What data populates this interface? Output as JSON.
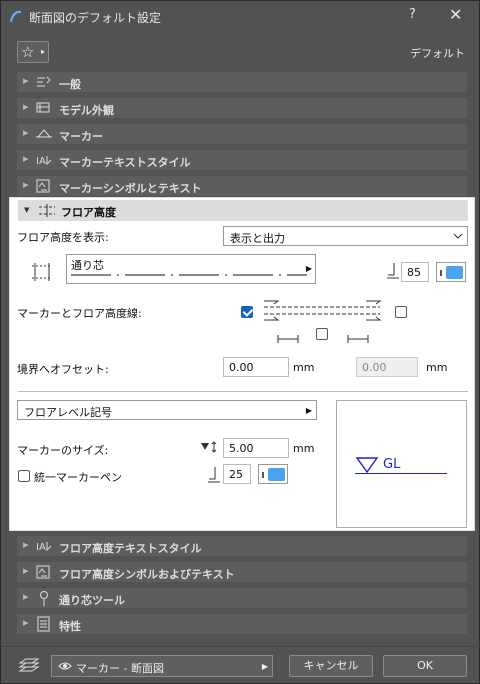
{
  "window": {
    "title": "断面図のデフォルト設定",
    "help": "?",
    "close": "✕"
  },
  "favorites": {
    "star": "☆",
    "arrow": "▸"
  },
  "default_label": "デフォルト",
  "sections": [
    {
      "label": "一般"
    },
    {
      "label": "モデル外観"
    },
    {
      "label": "マーカー"
    },
    {
      "label": "マーカーテキストスタイル"
    },
    {
      "label": "マーカーシンボルとテキスト"
    }
  ],
  "floor_panel": {
    "header": "フロア高度",
    "show_label": "フロア高度を表示:",
    "show_value": "表示と出力",
    "line_name": "通り芯",
    "pen_number": "85",
    "marker_line_label": "マーカーとフロア高度線:",
    "offset_label": "境界へオフセット:",
    "offset_value": "0.00",
    "offset_unit": "mm",
    "offset2_value": "0.00",
    "offset2_unit": "mm",
    "symbol_value": "フロアレベル記号",
    "marker_size_label": "マーカーのサイズ:",
    "marker_size_value": "5.00",
    "marker_size_unit": "mm",
    "uniform_pen_label": "統一マーカーペン",
    "marker_pen_number": "25",
    "preview_text": "GL"
  },
  "sections_after": [
    {
      "label": "フロア高度テキストスタイル"
    },
    {
      "label": "フロア高度シンボルおよびテキスト"
    },
    {
      "label": "通り芯ツール"
    },
    {
      "label": "特性"
    }
  ],
  "footer": {
    "layer": "マーカー - 断面図",
    "cancel": "キャンセル",
    "ok": "OK"
  },
  "colors": {
    "accent": "#1565c0",
    "pen_swatch": "#4aa3f0",
    "preview_blue": "#2222cc"
  }
}
